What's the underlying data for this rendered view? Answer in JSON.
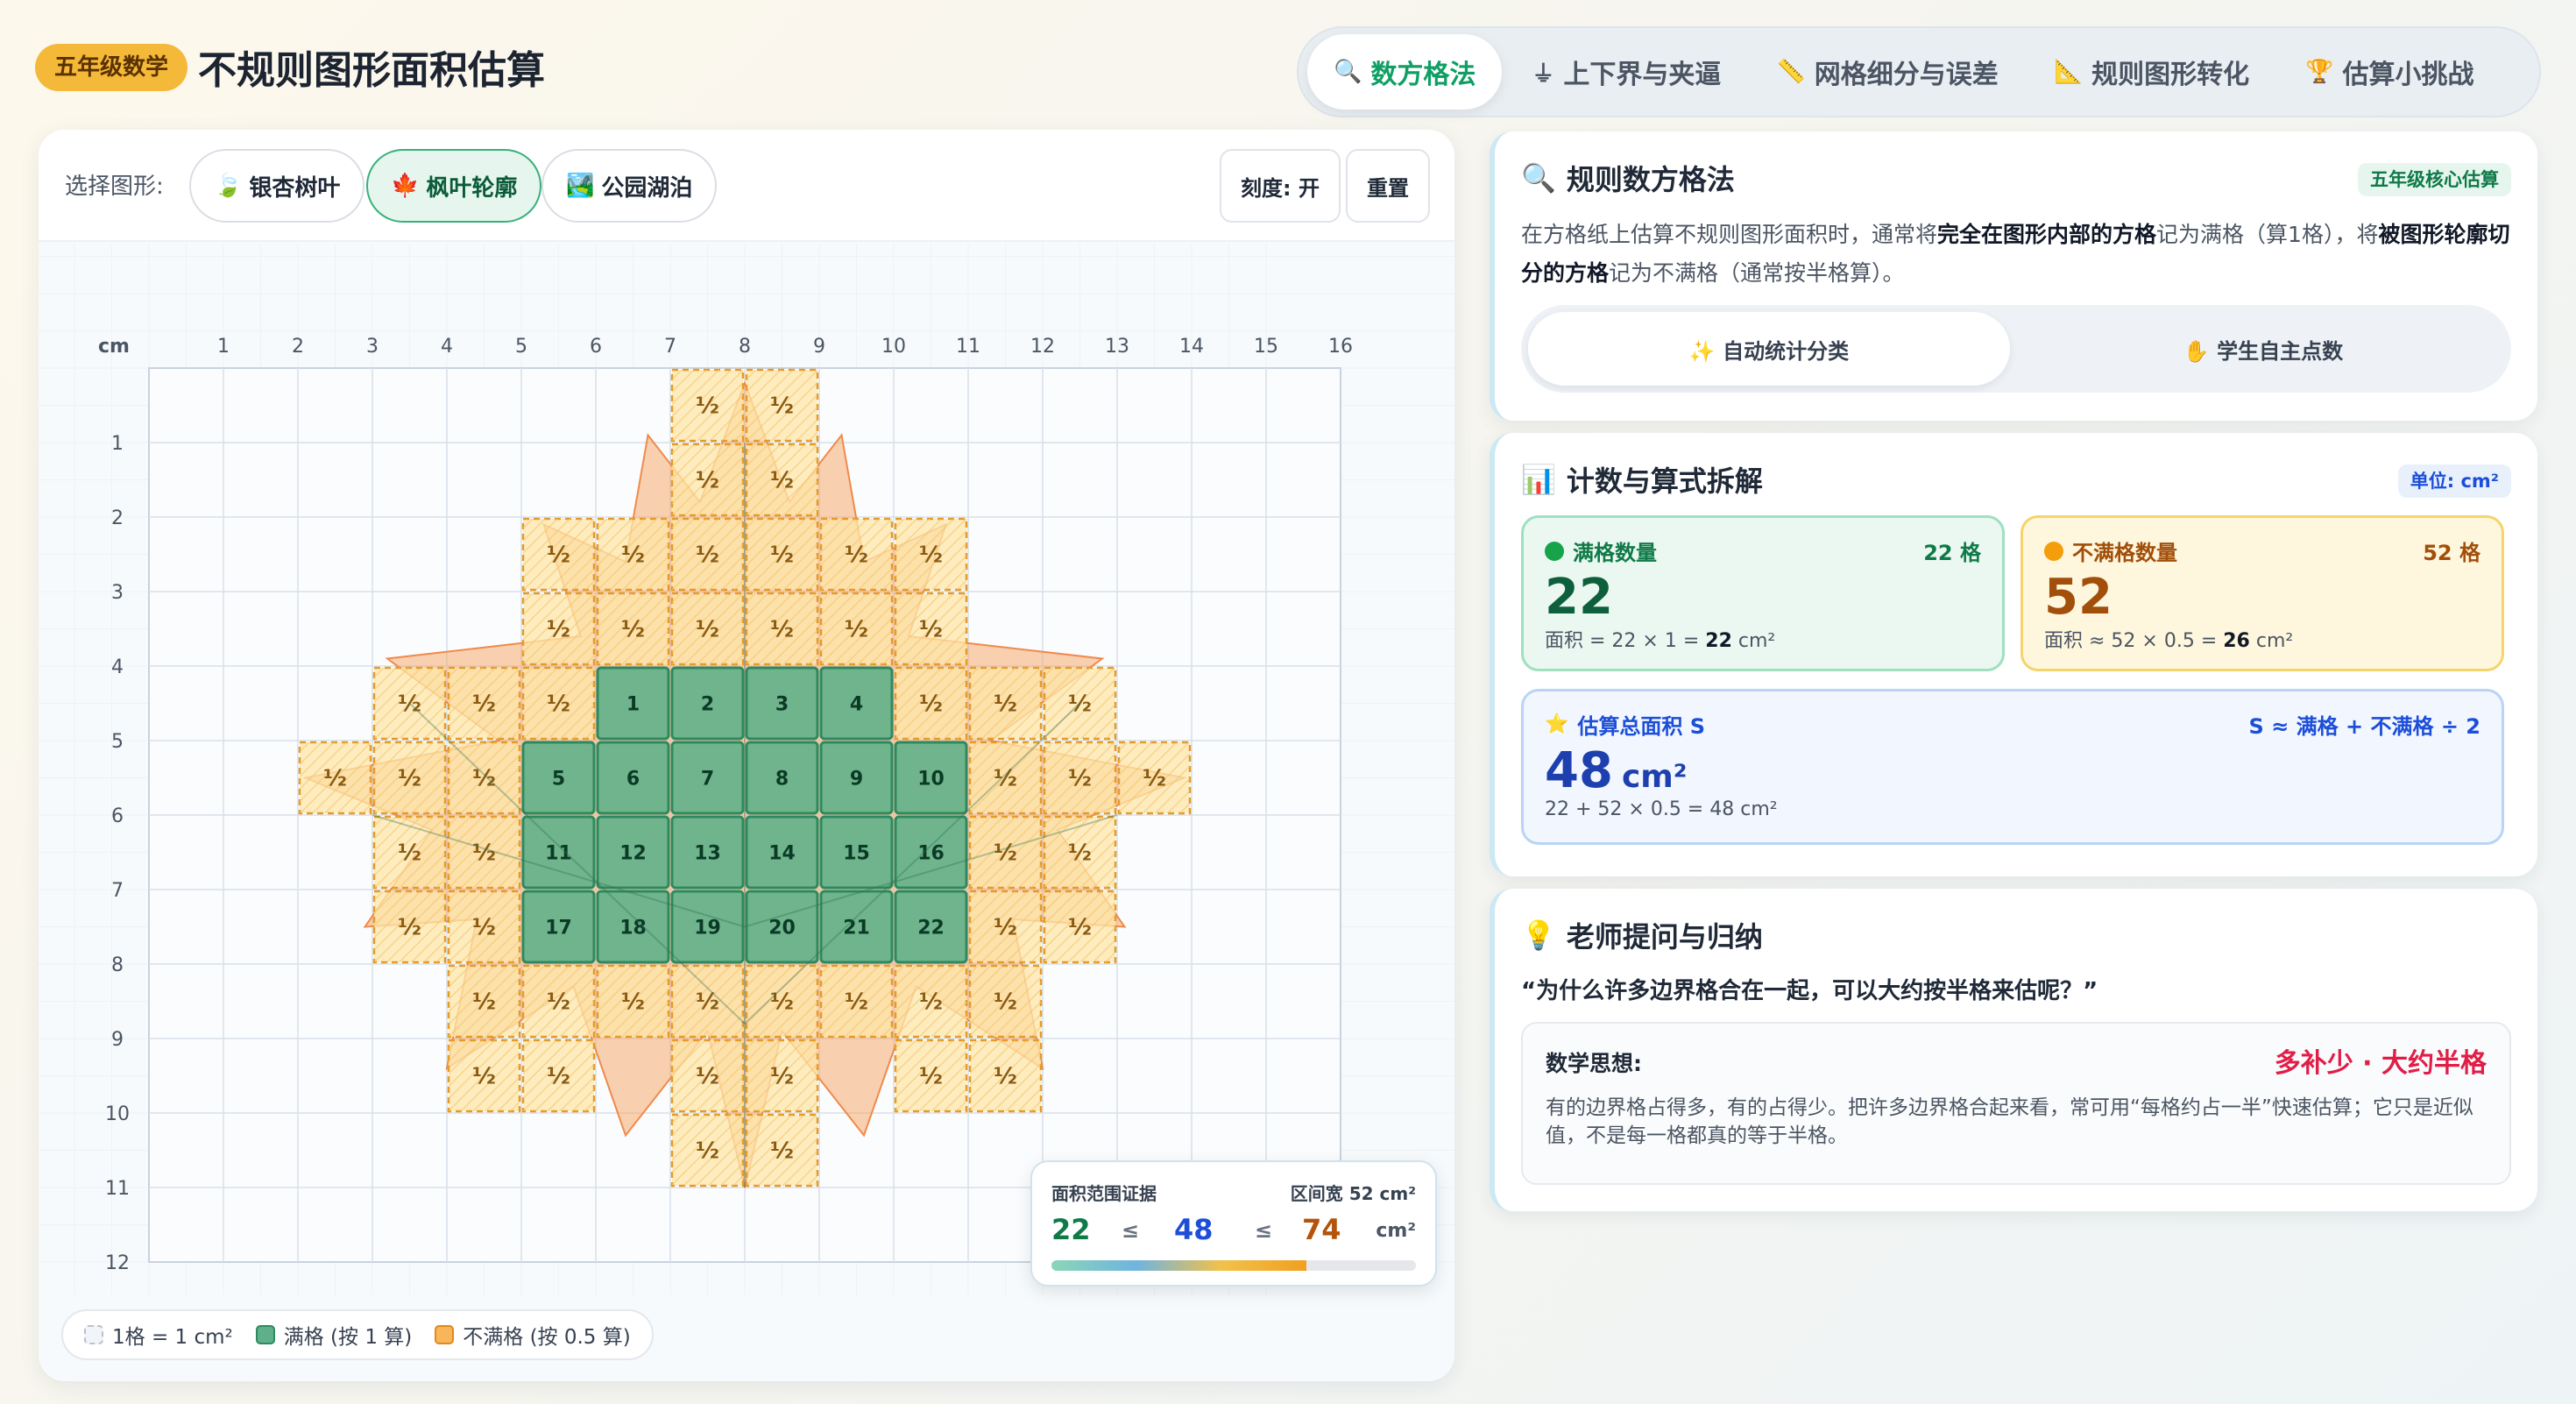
{
  "header": {
    "grade_badge": "五年级数学",
    "title": "不规则图形面积估算",
    "tabs": [
      {
        "icon": "🔍",
        "label": "数方格法",
        "active": true
      },
      {
        "icon": "⏚",
        "label": "上下界与夹逼",
        "active": false
      },
      {
        "icon": "📏",
        "label": "网格细分与误差",
        "active": false
      },
      {
        "icon": "📐",
        "label": "规则图形转化",
        "active": false
      },
      {
        "icon": "🏆",
        "label": "估算小挑战",
        "active": false
      }
    ]
  },
  "toolbar": {
    "select_label": "选择图形:",
    "shapes": [
      {
        "icon": "🍃",
        "label": "银杏树叶",
        "active": false
      },
      {
        "icon": "🍁",
        "label": "枫叶轮廓",
        "active": true
      },
      {
        "icon": "🏞️",
        "label": "公园湖泊",
        "active": false
      }
    ],
    "scale_button": "刻度: 开",
    "reset_button": "重置"
  },
  "grid": {
    "unit_label": "cm",
    "x_ticks": [
      "1",
      "2",
      "3",
      "4",
      "5",
      "6",
      "7",
      "8",
      "9",
      "10",
      "11",
      "12",
      "13",
      "14",
      "15",
      "16"
    ],
    "y_ticks": [
      "1",
      "2",
      "3",
      "4",
      "5",
      "6",
      "7",
      "8",
      "9",
      "10",
      "11",
      "12"
    ],
    "half_mark": "½",
    "full_cells": [
      [
        6,
        4
      ],
      [
        7,
        4
      ],
      [
        8,
        4
      ],
      [
        9,
        4
      ],
      [
        5,
        5
      ],
      [
        6,
        5
      ],
      [
        7,
        5
      ],
      [
        8,
        5
      ],
      [
        9,
        5
      ],
      [
        10,
        5
      ],
      [
        5,
        6
      ],
      [
        6,
        6
      ],
      [
        7,
        6
      ],
      [
        8,
        6
      ],
      [
        9,
        6
      ],
      [
        10,
        6
      ],
      [
        5,
        7
      ],
      [
        6,
        7
      ],
      [
        7,
        7
      ],
      [
        8,
        7
      ],
      [
        9,
        7
      ],
      [
        10,
        7
      ]
    ],
    "partial_cells": [
      [
        7,
        0
      ],
      [
        8,
        0
      ],
      [
        7,
        1
      ],
      [
        8,
        1
      ],
      [
        5,
        2
      ],
      [
        6,
        2
      ],
      [
        7,
        2
      ],
      [
        8,
        2
      ],
      [
        9,
        2
      ],
      [
        10,
        2
      ],
      [
        5,
        3
      ],
      [
        6,
        3
      ],
      [
        7,
        3
      ],
      [
        8,
        3
      ],
      [
        9,
        3
      ],
      [
        10,
        3
      ],
      [
        3,
        4
      ],
      [
        4,
        4
      ],
      [
        5,
        4
      ],
      [
        10,
        4
      ],
      [
        11,
        4
      ],
      [
        12,
        4
      ],
      [
        2,
        5
      ],
      [
        3,
        5
      ],
      [
        4,
        5
      ],
      [
        11,
        5
      ],
      [
        12,
        5
      ],
      [
        13,
        5
      ],
      [
        3,
        6
      ],
      [
        4,
        6
      ],
      [
        11,
        6
      ],
      [
        12,
        6
      ],
      [
        3,
        7
      ],
      [
        4,
        7
      ],
      [
        11,
        7
      ],
      [
        12,
        7
      ],
      [
        4,
        8
      ],
      [
        5,
        8
      ],
      [
        6,
        8
      ],
      [
        7,
        8
      ],
      [
        8,
        8
      ],
      [
        9,
        8
      ],
      [
        10,
        8
      ],
      [
        11,
        8
      ],
      [
        4,
        9
      ],
      [
        5,
        9
      ],
      [
        7,
        9
      ],
      [
        8,
        9
      ],
      [
        10,
        9
      ],
      [
        11,
        9
      ],
      [
        7,
        10
      ],
      [
        8,
        10
      ]
    ]
  },
  "legend": {
    "unit": "1格 = 1 cm²",
    "full": "满格 (按 1 算)",
    "partial": "不满格 (按 0.5 算)"
  },
  "range_card": {
    "title": "面积范围证据",
    "width_label": "区间宽 52 cm²",
    "lower": "22",
    "le1": "≤",
    "estimate": "48",
    "le2": "≤",
    "upper": "74",
    "unit": "cm²",
    "fill_fraction": 0.7
  },
  "method_card": {
    "icon": "🔍",
    "title": "规则数方格法",
    "badge": "五年级核心估算",
    "desc_1": "在方格纸上估算不规则图形面积时，通常将",
    "desc_b1": "完全在图形内部的方格",
    "desc_2": "记为满格（算1格），将",
    "desc_b2": "被图形轮廓切分的方格",
    "desc_3": "记为不满格（通常按半格算）。",
    "mode_auto": "✨ 自动统计分类",
    "mode_manual": "✋ 学生自主点数"
  },
  "count_card": {
    "icon": "📊",
    "title": "计数与算式拆解",
    "badge": "单位: cm²",
    "full_label": "满格数量",
    "full_count": "22 格",
    "full_big": "22",
    "full_formula_pre": "面积 = 22 × 1 = ",
    "full_formula_val": "22",
    "full_formula_unit": " cm²",
    "part_label": "不满格数量",
    "part_count": "52 格",
    "part_big": "52",
    "part_formula_pre": "面积 ≈ 52 × 0.5 = ",
    "part_formula_val": "26",
    "part_formula_unit": " cm²",
    "total_label": "估算总面积 S",
    "total_rule": "S ≈ 满格 + 不满格 ÷ 2",
    "total_big": "48",
    "total_unit": "cm²",
    "total_formula": "22 + 52 × 0.5 = 48 cm²"
  },
  "teacher_card": {
    "icon": "💡",
    "title": "老师提问与归纳",
    "question": "“为什么许多边界格合在一起，可以大约按半格来估呢？”",
    "idea_label": "数学思想:",
    "idea_slogan": "多补少 · 大约半格",
    "idea_text": "有的边界格占得多，有的占得少。把许多边界格合起来看，常可用“每格约占一半”快速估算；它只是近似值，不是每一格都真的等于半格。"
  },
  "colors": {
    "full_fill": "#5fb08a",
    "full_stroke": "#2e8a5e",
    "partial_fill": "#ffe7a8",
    "partial_stroke": "#e59a2a",
    "leaf": "#f6a96e",
    "accent": "#0f9f63"
  }
}
